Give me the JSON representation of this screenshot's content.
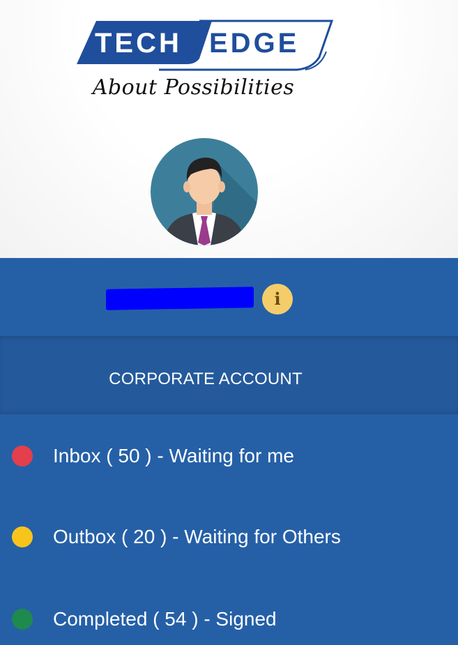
{
  "brand": {
    "logo_left": "TECH",
    "logo_right": "EDGE",
    "tagline": "About Possibilities",
    "colors": {
      "primary": "#1f4e9c",
      "panel": "#2560a7"
    }
  },
  "user": {
    "avatar_icon": "businessman-avatar-icon",
    "name_redacted": true,
    "info_icon": "info-icon",
    "info_glyph": "i"
  },
  "account": {
    "label": "CORPORATE ACCOUNT"
  },
  "menu": [
    {
      "label": "Inbox ( 50 ) - Waiting for me",
      "dot_color": "#e43f4c"
    },
    {
      "label": "Outbox ( 20 ) - Waiting for Others",
      "dot_color": "#f7c41c"
    },
    {
      "label": "Completed ( 54 ) - Signed",
      "dot_color": "#1e8a4e"
    }
  ]
}
